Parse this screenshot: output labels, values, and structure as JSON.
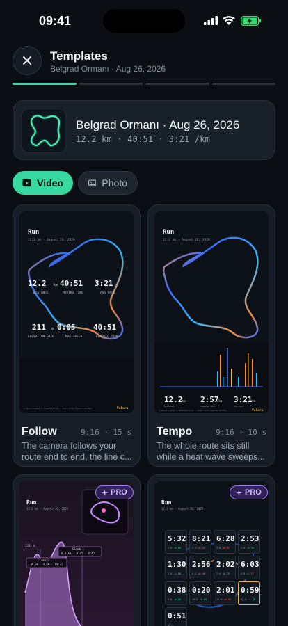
{
  "status": {
    "time": "09:41"
  },
  "header": {
    "title": "Templates",
    "subtitle": "Belgrad Ormanı · Aug 26, 2026",
    "steps_total": 4,
    "step_current": 1
  },
  "route": {
    "title": "Belgrad Ormanı · Aug 26, 2026",
    "stats": "12.2 km · 40:51 · 3:21 /km"
  },
  "toggle": {
    "video_label": "Video",
    "photo_label": "Photo",
    "selected": "Video"
  },
  "colors": {
    "accent": "#37d9a0",
    "pro": "#9d7bf0",
    "route_blue": "#3b6fff",
    "route_orange": "#ff8a3d"
  },
  "preview_common": {
    "sport": "Run",
    "date_line": "12.2 km · August 26, 2026",
    "brand": "Velora",
    "attribution": "© OpenFreeMap © OpenMapTiles · Data from OpenStreetMap"
  },
  "templates": [
    {
      "name": "Follow",
      "aspect": "9:16",
      "duration": "15 s",
      "description": "The camera follows your route end to end, the line c...",
      "pro": false,
      "stats_row1": [
        {
          "value": "12.2",
          "unit": "km",
          "label": "DISTANCE"
        },
        {
          "value": "40:51",
          "unit": "",
          "label": "MOVING TIME"
        },
        {
          "value": "3:21",
          "unit": "",
          "label": "AVG PACE"
        }
      ],
      "stats_row2": [
        {
          "value": "211",
          "unit": "m",
          "label": "ELEVATION GAIN"
        },
        {
          "value": "0:05",
          "unit": "",
          "label": "MAX SPEED"
        },
        {
          "value": "40:51",
          "unit": "",
          "label": "ELAPSED TIME"
        }
      ]
    },
    {
      "name": "Tempo",
      "aspect": "9:16",
      "duration": "10 s",
      "description": "The whole route sits still while a heat wave sweeps...",
      "pro": false,
      "stats": [
        {
          "value": "12.2",
          "unit": "km",
          "label": "DISTANCE"
        },
        {
          "value": "2:57",
          "unit": "/km",
          "label": "CURRENT PACE"
        },
        {
          "value": "3:21",
          "unit": "/km",
          "label": "AVG PACE"
        }
      ]
    },
    {
      "name": "",
      "pro": true,
      "pro_label": "PRO",
      "axis_value": "221 m",
      "callouts": [
        {
          "title": "Climb 1",
          "text": "0.4 km · 0.45 · 0:42"
        },
        {
          "title": "Climb 2",
          "text": "3.8 km · 4.5% · 10:32"
        }
      ]
    },
    {
      "name": "",
      "pro": true,
      "pro_label": "PRO",
      "splits": [
        {
          "pace": "5:32",
          "km": "1.0",
          "delta": "-0.06"
        },
        {
          "pace": "8:21",
          "km": "2.0",
          "delta": "+0.41"
        },
        {
          "pace": "6:28",
          "km": "3.0",
          "delta": "+0.31"
        },
        {
          "pace": "2:53",
          "km": "4.0",
          "delta": "-0.34"
        },
        {
          "pace": "1:30",
          "km": "5.0",
          "delta": "-1.06"
        },
        {
          "pace": "2:56",
          "km": "6.0",
          "delta": "+0.40"
        },
        {
          "pace": "2:02",
          "km": "7.0",
          "delta": "-0.75"
        },
        {
          "pace": "6:03",
          "km": "8.0",
          "delta": "+1.27"
        },
        {
          "pace": "0:38",
          "km": "9.0",
          "delta": "-0.26"
        },
        {
          "pace": "0:20",
          "km": "10.0",
          "delta": "-0.05"
        },
        {
          "pace": "2:01",
          "km": "11.0",
          "delta": "+0.15"
        },
        {
          "pace": "0:59",
          "km": "12.0",
          "delta": "-1.56"
        },
        {
          "pace": "0:51",
          "km": "12.2",
          "delta": ""
        }
      ]
    }
  ]
}
